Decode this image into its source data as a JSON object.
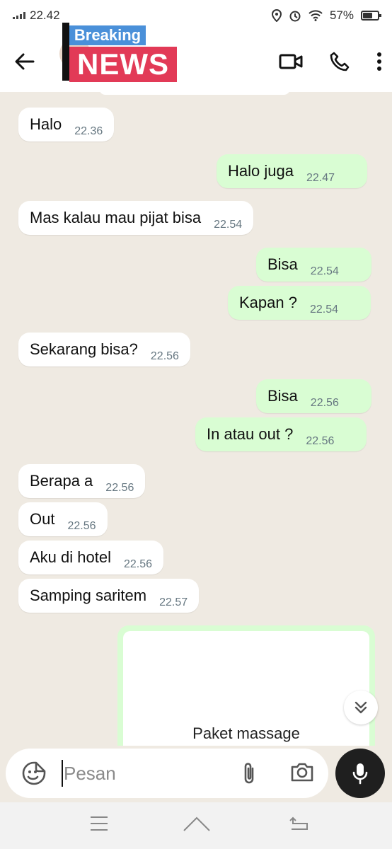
{
  "status_bar": {
    "time": "22.42",
    "battery": "57%"
  },
  "header": {
    "logo_top": "Breaking",
    "logo_bottom": "NEWS"
  },
  "messages": [
    {
      "dir": "in",
      "text": "Halo",
      "time": "22.36"
    },
    {
      "dir": "out",
      "text": "Halo juga",
      "time": "22.47"
    },
    {
      "dir": "in",
      "text": "Mas kalau mau pijat bisa",
      "time": "22.54"
    },
    {
      "dir": "out",
      "text": "Bisa",
      "time": "22.54"
    },
    {
      "dir": "out",
      "text": "Kapan ?",
      "time": "22.54"
    },
    {
      "dir": "in",
      "text": "Sekarang bisa?",
      "time": "22.56"
    },
    {
      "dir": "out",
      "text": "Bisa",
      "time": "22.56"
    },
    {
      "dir": "out",
      "text": "In atau out ?",
      "time": "22.56"
    },
    {
      "dir": "in",
      "text": "Berapa a",
      "time": "22.56"
    },
    {
      "dir": "in",
      "text": "Out",
      "time": "22.56"
    },
    {
      "dir": "in",
      "text": "Aku di hotel",
      "time": "22.56"
    },
    {
      "dir": "in",
      "text": "Samping saritem",
      "time": "22.57"
    }
  ],
  "media": {
    "caption": "Paket massage"
  },
  "input": {
    "placeholder": "Pesan"
  },
  "icons": {
    "back": "arrow-left-icon",
    "video": "video-call-icon",
    "call": "phone-icon",
    "menu": "more-vert-icon",
    "emoji": "sticker-icon",
    "attach": "paperclip-icon",
    "camera": "camera-icon",
    "mic": "mic-icon",
    "scroll": "double-chevron-down-icon",
    "read": "double-check-icon"
  },
  "colors": {
    "outgoing": "#d9fdd3",
    "incoming": "#ffffff",
    "read_ticks": "#53bdeb",
    "background": "#efeae2"
  }
}
